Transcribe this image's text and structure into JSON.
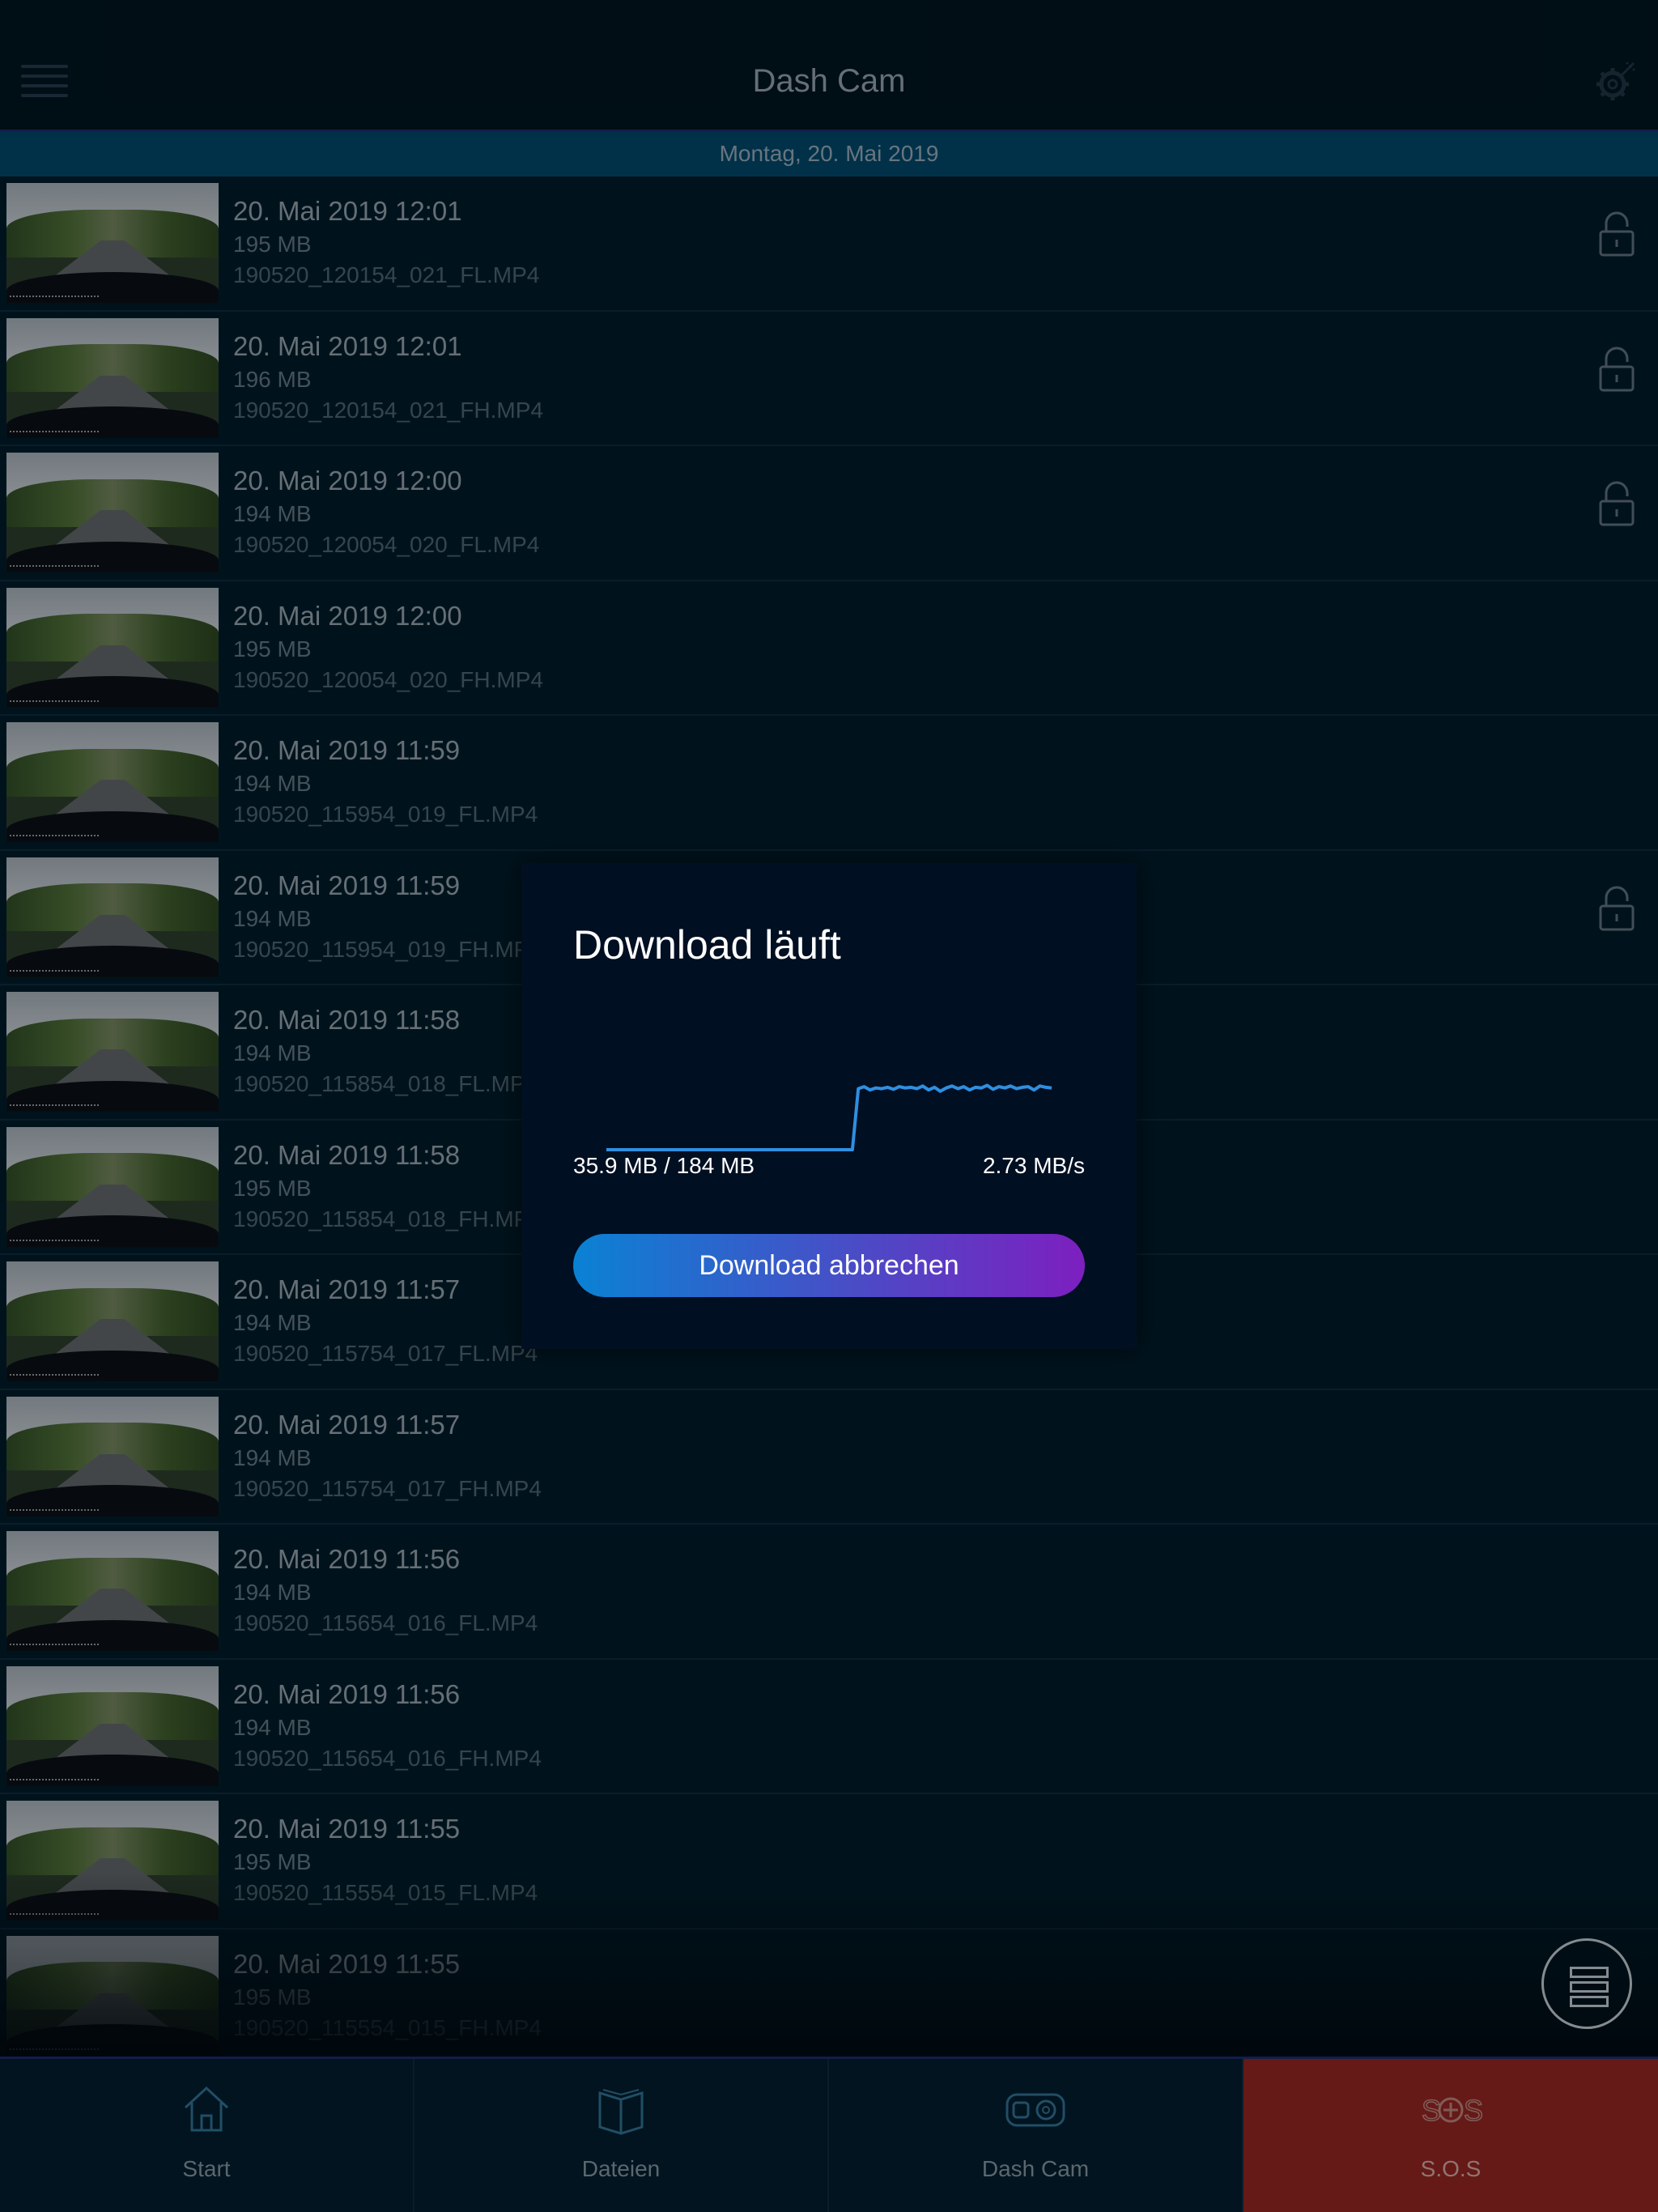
{
  "header": {
    "title": "Dash Cam",
    "menu_icon": "hamburger-menu-icon",
    "settings_icon": "gear-icon"
  },
  "date_group": "Montag, 20. Mai 2019",
  "files": [
    {
      "datetime": "20. Mai 2019 12:01",
      "size": "195 MB",
      "filename": "190520_120154_021_FL.MP4",
      "locked": true
    },
    {
      "datetime": "20. Mai 2019 12:01",
      "size": "196 MB",
      "filename": "190520_120154_021_FH.MP4",
      "locked": true
    },
    {
      "datetime": "20. Mai 2019 12:00",
      "size": "194 MB",
      "filename": "190520_120054_020_FL.MP4",
      "locked": true
    },
    {
      "datetime": "20. Mai 2019 12:00",
      "size": "195 MB",
      "filename": "190520_120054_020_FH.MP4",
      "locked": false
    },
    {
      "datetime": "20. Mai 2019 11:59",
      "size": "194 MB",
      "filename": "190520_115954_019_FL.MP4",
      "locked": false
    },
    {
      "datetime": "20. Mai 2019 11:59",
      "size": "194 MB",
      "filename": "190520_115954_019_FH.MP4",
      "locked": true
    },
    {
      "datetime": "20. Mai 2019 11:58",
      "size": "194 MB",
      "filename": "190520_115854_018_FL.MP4",
      "locked": false
    },
    {
      "datetime": "20. Mai 2019 11:58",
      "size": "195 MB",
      "filename": "190520_115854_018_FH.MP4",
      "locked": false
    },
    {
      "datetime": "20. Mai 2019 11:57",
      "size": "194 MB",
      "filename": "190520_115754_017_FL.MP4",
      "locked": false
    },
    {
      "datetime": "20. Mai 2019 11:57",
      "size": "194 MB",
      "filename": "190520_115754_017_FH.MP4",
      "locked": false
    },
    {
      "datetime": "20. Mai 2019 11:56",
      "size": "194 MB",
      "filename": "190520_115654_016_FL.MP4",
      "locked": false
    },
    {
      "datetime": "20. Mai 2019 11:56",
      "size": "194 MB",
      "filename": "190520_115654_016_FH.MP4",
      "locked": false
    },
    {
      "datetime": "20. Mai 2019 11:55",
      "size": "195 MB",
      "filename": "190520_115554_015_FL.MP4",
      "locked": false
    },
    {
      "datetime": "20. Mai 2019 11:55",
      "size": "195 MB",
      "filename": "190520_115554_015_FH.MP4",
      "locked": false
    }
  ],
  "modal": {
    "title": "Download läuft",
    "progress_text": "35.9 MB / 184 MB",
    "speed_text": "2.73 MB/s",
    "cancel_label": "Download abbrechen",
    "accent_color": "#2f8fe0",
    "speed_history": [
      0,
      0,
      0,
      0,
      0,
      0,
      0,
      0,
      0,
      0,
      0,
      0,
      0,
      0,
      0,
      0,
      0,
      0,
      0,
      0,
      0,
      0,
      0,
      0,
      0,
      0,
      0,
      0,
      0,
      0,
      0,
      0,
      0,
      0,
      0,
      0,
      0,
      0,
      0,
      0,
      0,
      0,
      0,
      0.92,
      0.95,
      0.9,
      0.93,
      0.92,
      0.94,
      0.91,
      0.95,
      0.93,
      0.94,
      0.92,
      0.96,
      0.9,
      0.94,
      0.88,
      0.93,
      0.96,
      0.92,
      0.95,
      0.9,
      0.94,
      0.93,
      0.97,
      0.91,
      0.95,
      0.93,
      0.96,
      0.92,
      0.94,
      0.95,
      0.9,
      0.96,
      0.94,
      0.93
    ]
  },
  "nav": [
    {
      "label": "Start",
      "icon": "home-icon"
    },
    {
      "label": "Dateien",
      "icon": "book-icon"
    },
    {
      "label": "Dash Cam",
      "icon": "dashcam-icon"
    },
    {
      "label": "S.O.S",
      "icon": "sos-icon"
    }
  ],
  "colors": {
    "background": "#001826",
    "date_bar": "#014566",
    "sos": "#8c2420"
  }
}
